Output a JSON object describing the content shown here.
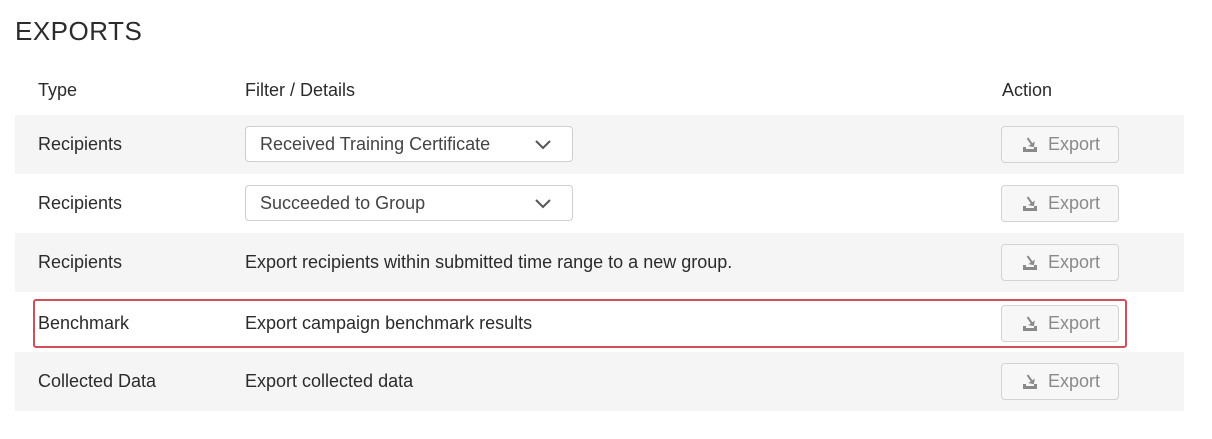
{
  "page": {
    "title": "EXPORTS"
  },
  "columns": {
    "type": "Type",
    "details": "Filter / Details",
    "action": "Action"
  },
  "rows": [
    {
      "type": "Recipients",
      "kind": "select",
      "detail": "Received Training Certificate",
      "action": "Export"
    },
    {
      "type": "Recipients",
      "kind": "select",
      "detail": "Succeeded to Group",
      "action": "Export"
    },
    {
      "type": "Recipients",
      "kind": "text",
      "detail": "Export recipients within submitted time range to a new group.",
      "action": "Export"
    },
    {
      "type": "Benchmark",
      "kind": "text",
      "detail": "Export campaign benchmark results",
      "action": "Export",
      "highlighted": true
    },
    {
      "type": "Collected Data",
      "kind": "text",
      "detail": "Export collected data",
      "action": "Export"
    }
  ],
  "colors": {
    "highlight_border": "#d0505a",
    "row_shade": "#f5f5f5"
  },
  "icons": {
    "export": "export-icon",
    "dropdown": "chevron-down-icon"
  }
}
